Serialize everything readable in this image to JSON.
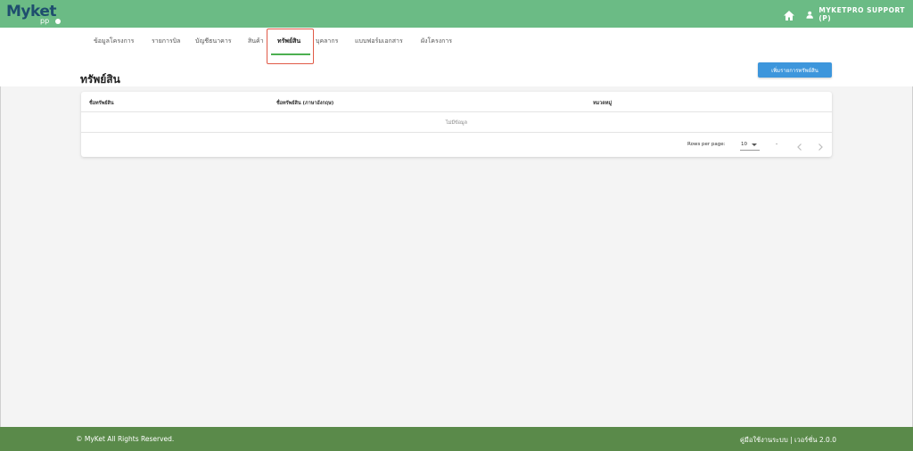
{
  "app": {
    "logo_text": "Myket",
    "logo_sub": "pp",
    "user_name": "MYKETPRO SUPPORT (P)"
  },
  "nav": {
    "tabs": [
      {
        "label": "ข้อมูลโครงการ"
      },
      {
        "label": "รายการบิล"
      },
      {
        "label": "บัญชีธนาคาร"
      },
      {
        "label": "สินค้า"
      },
      {
        "label": "ทรัพย์สิน",
        "active": true
      },
      {
        "label": "บุคลากร"
      },
      {
        "label": "แบบฟอร์มเอกสาร"
      },
      {
        "label": "ผังโครงการ"
      }
    ]
  },
  "page": {
    "title": "ทรัพย์สิน",
    "add_button": "เพิ่มรายการทรัพย์สิน"
  },
  "table": {
    "columns": [
      "ชื่อทรัพย์สิน",
      "ชื่อทรัพย์สิน (ภาษาอังกฤษ)",
      "หมวดหมู่"
    ],
    "empty_text": "ไม่มีข้อมูล",
    "rows_per_page_label": "Rows per page:",
    "rows_per_page_value": "10",
    "range_text": "-"
  },
  "footer": {
    "copyright": "© MyKet All Rights Reserved.",
    "manual_link": "คู่มือใช้งานระบบ | เวอร์ชั่น 2.0.0"
  },
  "colors": {
    "topbar": "#6bbb85",
    "accent_button": "#3d96dc",
    "active_tab_underline": "#4caf50",
    "highlight_box": "#e05a47",
    "footer": "#5a8a4a"
  }
}
